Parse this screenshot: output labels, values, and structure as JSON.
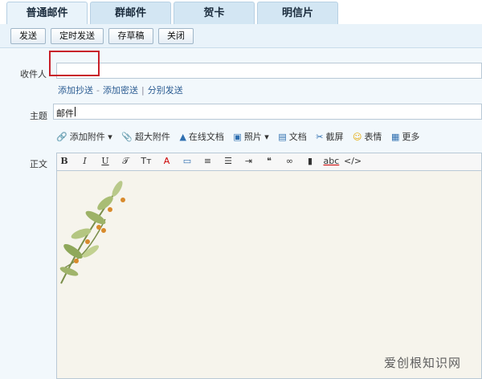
{
  "tabs": [
    {
      "label": "普通邮件",
      "active": true
    },
    {
      "label": "群邮件",
      "active": false
    },
    {
      "label": "贺卡",
      "active": false
    },
    {
      "label": "明信片",
      "active": false
    }
  ],
  "toolbar": {
    "send": "发送",
    "scheduled_send": "定时发送",
    "save_draft": "存草稿",
    "close": "关闭"
  },
  "compose": {
    "recipient_label": "收件人",
    "recipient_value": "",
    "add_cc": "添加抄送",
    "add_bcc": "添加密送",
    "separate_send": "分别发送",
    "subject_label": "主题",
    "subject_value": "邮件",
    "body_label": "正文"
  },
  "attachments": {
    "add_attachment": "添加附件",
    "large_attachment": "超大附件",
    "online_doc": "在线文档",
    "photo": "照片",
    "document": "文档",
    "screenshot": "截屏",
    "emoji": "表情",
    "more": "更多"
  },
  "editor_tools": [
    "B",
    "I",
    "U",
    "abc",
    "</>"
  ],
  "watermark": "爱创根知识网",
  "colors": {
    "accent": "#2b5c92",
    "highlight": "#c8202a",
    "tab_bg": "#d3e6f3"
  }
}
